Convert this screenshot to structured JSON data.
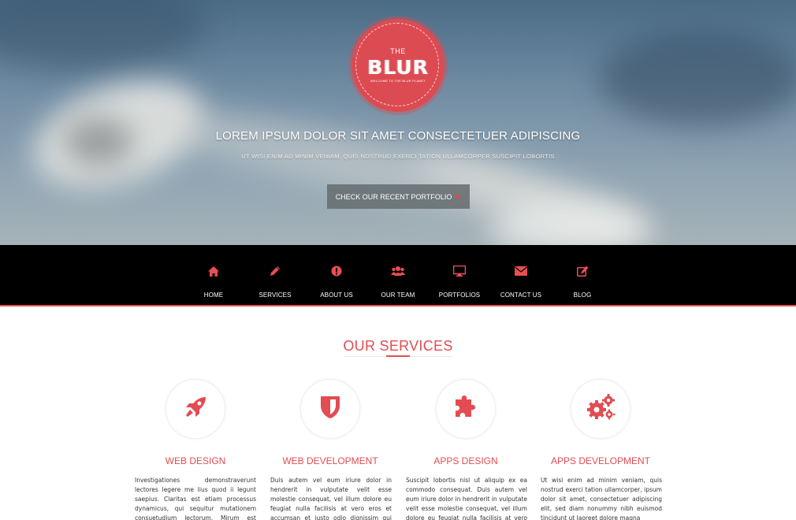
{
  "hero": {
    "logo": {
      "the": "THE",
      "main": "BLUR",
      "tagline": "WELCOME TO THE BLUR PLANET"
    },
    "title": "LOREM IPSUM DOLOR SIT AMET CONSECTETUER ADIPISCING",
    "subtitle": "UT WISI ENIM AD MINIM VENIAM, QUIS NOSTRUD EXERCI TATION ULLAMCORPER SUSCIPIT LOBORTIS",
    "button_label": "CHECK OUR RECENT PORTFOLIO",
    "button_icon": "arrow-right-icon"
  },
  "nav": {
    "items": [
      {
        "label": "HOME",
        "icon": "home-icon"
      },
      {
        "label": "SERVICES",
        "icon": "pencil-icon"
      },
      {
        "label": "ABOUT US",
        "icon": "exclamation-icon"
      },
      {
        "label": "OUR TEAM",
        "icon": "users-icon"
      },
      {
        "label": "PORTFOLIOS",
        "icon": "monitor-icon"
      },
      {
        "label": "CONTACT US",
        "icon": "envelope-icon"
      },
      {
        "label": "BLOG",
        "icon": "edit-icon"
      }
    ]
  },
  "services": {
    "title": "OUR SERVICES",
    "items": [
      {
        "title": "WEB DESIGN",
        "icon": "rocket-icon",
        "text": "Investigationes demonstraverunt lectores legere me lius quod ii legunt saepius. Claritas est etiam processus dynamicus, qui sequitur mutationem consuetudium lectorum. Mirum est notare quam littera"
      },
      {
        "title": "WEB DEVELOPMENT",
        "icon": "shield-icon",
        "text": "Duis autem vel eum iriure dolor in hendrerit in vulputate velit esse molestie consequat, vel illum dolore eu feugiat nulla facilisis at vero eros et accumsan et iusto odio dignissim qui blandit praesent"
      },
      {
        "title": "APPS DESIGN",
        "icon": "puzzle-icon",
        "text": "Suscipit lobortis nisl ut aliquip ex ea commodo consequat. Duis autem vel eum iriure dolor in hendrerit in vulputate velit esse molestie consequat, vel illum dolore eu feugiat nulla facilisis at vero eros et"
      },
      {
        "title": "APPS DEVELOPMENT",
        "icon": "gears-icon",
        "text": "Ut wisi enim ad minim veniam, quis nostrud exerci tation ullamcorper, ipsum dolor sit amet, consectetuer adipiscing elit, sed diam nonummy nibh euismod tincidunt ut laoreet dolore magna"
      }
    ]
  },
  "colors": {
    "accent": "#e24c52",
    "nav_background": "#000000",
    "nav_text": "#ffffff"
  }
}
